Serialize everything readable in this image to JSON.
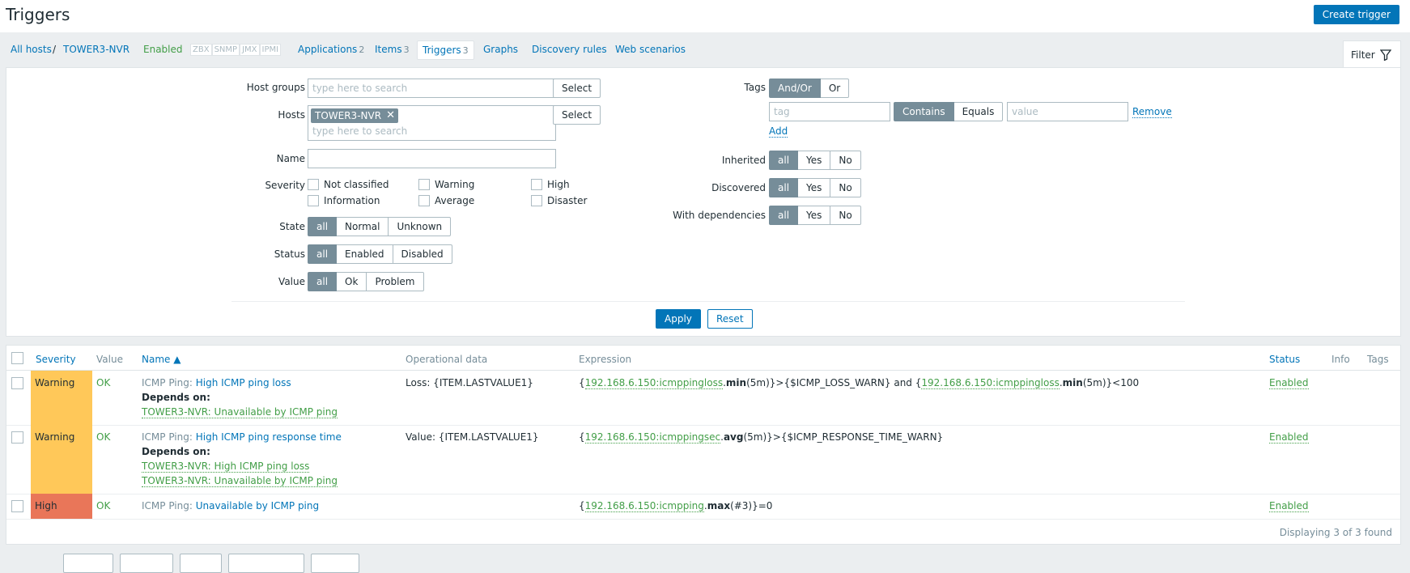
{
  "header": {
    "title": "Triggers",
    "create_label": "Create trigger"
  },
  "hostnav": {
    "all_hosts": "All hosts",
    "separator": "/",
    "host": "TOWER3-NVR",
    "status": "Enabled",
    "availability": [
      "ZBX",
      "SNMP",
      "JMX",
      "IPMI"
    ],
    "applications": {
      "label": "Applications",
      "count": "2"
    },
    "items": {
      "label": "Items",
      "count": "3"
    },
    "triggers": {
      "label": "Triggers",
      "count": "3"
    },
    "graphs": "Graphs",
    "discovery": "Discovery rules",
    "web": "Web scenarios",
    "filter_label": "Filter"
  },
  "filter": {
    "host_groups_label": "Host groups",
    "hosts_label": "Hosts",
    "name_label": "Name",
    "severity_label": "Severity",
    "state_label": "State",
    "status_label": "Status",
    "value_label": "Value",
    "search_placeholder": "type here to search",
    "select_label": "Select",
    "host_chip": "TOWER3-NVR",
    "name_value": "",
    "severities": [
      "Not classified",
      "Information",
      "Warning",
      "Average",
      "High",
      "Disaster"
    ],
    "state_options": [
      "all",
      "Normal",
      "Unknown"
    ],
    "status_options": [
      "all",
      "Enabled",
      "Disabled"
    ],
    "value_options": [
      "all",
      "Ok",
      "Problem"
    ],
    "tags_label": "Tags",
    "tags_options": [
      "And/Or",
      "Or"
    ],
    "tag_placeholder": "tag",
    "match_options": [
      "Contains",
      "Equals"
    ],
    "value_placeholder": "value",
    "remove_label": "Remove",
    "add_label": "Add",
    "inherited_label": "Inherited",
    "discovered_label": "Discovered",
    "dependencies_label": "With dependencies",
    "yes_no_options": [
      "all",
      "Yes",
      "No"
    ],
    "apply_label": "Apply",
    "reset_label": "Reset"
  },
  "table": {
    "headers": {
      "severity": "Severity",
      "value": "Value",
      "name": "Name ▲",
      "opdata": "Operational data",
      "expression": "Expression",
      "status": "Status",
      "info": "Info",
      "tags": "Tags"
    },
    "rows": [
      {
        "severity": "Warning",
        "severity_color": "#ffc859",
        "value": "OK",
        "prefix": "ICMP Ping",
        "name": "High ICMP ping loss",
        "depends_label": "Depends on:",
        "depends": [
          "TOWER3-NVR: Unavailable by ICMP ping"
        ],
        "opdata": "Loss: {ITEM.LASTVALUE1}",
        "expr_parts": [
          {
            "t": "{",
            "k": "plain"
          },
          {
            "t": "192.168.6.150:icmppingloss",
            "k": "item"
          },
          {
            "t": ".",
            "k": "plain"
          },
          {
            "t": "min",
            "k": "fn"
          },
          {
            "t": "(5m)}>{$ICMP_LOSS_WARN} and {",
            "k": "plain"
          },
          {
            "t": "192.168.6.150:icmppingloss",
            "k": "item"
          },
          {
            "t": ".",
            "k": "plain"
          },
          {
            "t": "min",
            "k": "fn"
          },
          {
            "t": "(5m)}<100",
            "k": "plain"
          }
        ],
        "status": "Enabled"
      },
      {
        "severity": "Warning",
        "severity_color": "#ffc859",
        "value": "OK",
        "prefix": "ICMP Ping",
        "name": "High ICMP ping response time",
        "depends_label": "Depends on:",
        "depends": [
          "TOWER3-NVR: High ICMP ping loss",
          "TOWER3-NVR: Unavailable by ICMP ping"
        ],
        "opdata": "Value: {ITEM.LASTVALUE1}",
        "expr_parts": [
          {
            "t": "{",
            "k": "plain"
          },
          {
            "t": "192.168.6.150:icmppingsec",
            "k": "item"
          },
          {
            "t": ".",
            "k": "plain"
          },
          {
            "t": "avg",
            "k": "fn"
          },
          {
            "t": "(5m)}>{$ICMP_RESPONSE_TIME_WARN}",
            "k": "plain"
          }
        ],
        "status": "Enabled"
      },
      {
        "severity": "High",
        "severity_color": "#e97659",
        "value": "OK",
        "prefix": "ICMP Ping",
        "name": "Unavailable by ICMP ping",
        "depends_label": "",
        "depends": [],
        "opdata": "",
        "expr_parts": [
          {
            "t": "{",
            "k": "plain"
          },
          {
            "t": "192.168.6.150:icmpping",
            "k": "item"
          },
          {
            "t": ".",
            "k": "plain"
          },
          {
            "t": "max",
            "k": "fn"
          },
          {
            "t": "(#3)}=0",
            "k": "plain"
          }
        ],
        "status": "Enabled"
      }
    ],
    "footer": "Displaying 3 of 3 found"
  }
}
